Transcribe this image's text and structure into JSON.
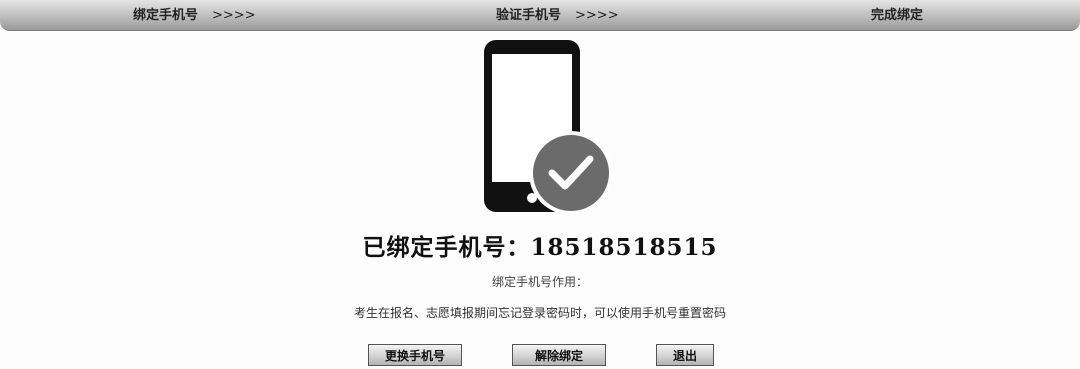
{
  "steps": [
    {
      "label": "绑定手机号",
      "arrows": ">>>>"
    },
    {
      "label": "验证手机号",
      "arrows": ">>>>"
    },
    {
      "label": "完成绑定"
    }
  ],
  "status": {
    "bound_label": "已绑定手机号：18518518515"
  },
  "usage": {
    "title": "绑定手机号作用：",
    "description": "考生在报名、志愿填报期间忘记登录密码时，可以使用手机号重置密码"
  },
  "actions": {
    "change_label": "更换手机号",
    "unbind_label": "解除绑定",
    "exit_label": "退出"
  },
  "colors": {
    "phone": "#111111",
    "check_badge": "#6b6b6b",
    "check_mark": "#ffffff"
  },
  "icons": {
    "phone": "smartphone-icon",
    "check": "checkmark-circle-icon"
  }
}
